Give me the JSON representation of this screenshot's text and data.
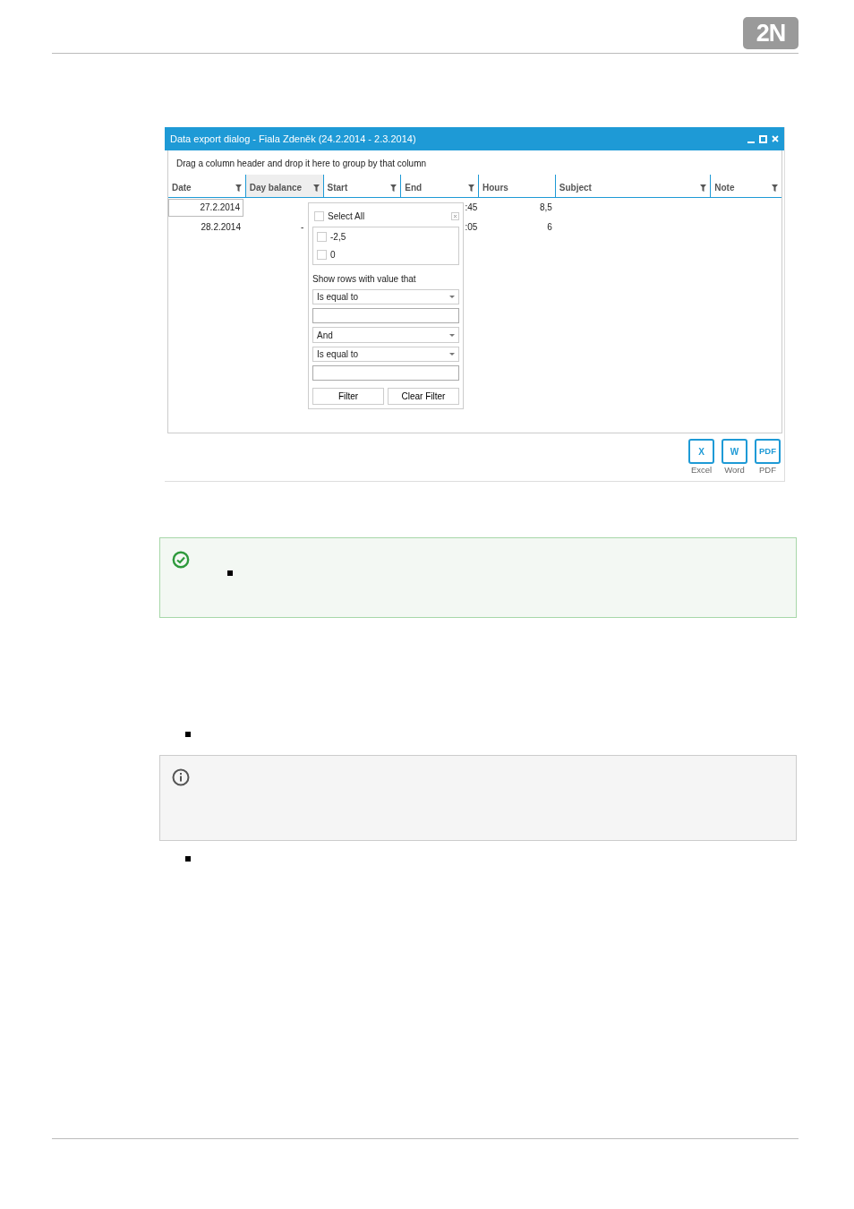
{
  "logo": "2N",
  "dialog": {
    "title": "Data export dialog - Fiala Zdeněk (24.2.2014 - 2.3.2014)",
    "group_hint": "Drag a column header and drop it here to group by that column",
    "columns": [
      {
        "label": "Date",
        "filter": true,
        "selected": false
      },
      {
        "label": "Day balance",
        "filter": true,
        "selected": true
      },
      {
        "label": "Start",
        "filter": true,
        "selected": false
      },
      {
        "label": "End",
        "filter": true,
        "selected": false
      },
      {
        "label": "Hours",
        "filter": false,
        "selected": false
      },
      {
        "label": "Subject",
        "filter": true,
        "selected": false
      },
      {
        "label": "Note",
        "filter": true,
        "selected": false
      }
    ],
    "rows": [
      {
        "date": "27.2.2014",
        "end": ":45",
        "hours": "8,5",
        "focused": true
      },
      {
        "date": "28.2.2014",
        "day_balance": "-",
        "end": ":05",
        "hours": "6",
        "focused": false
      }
    ],
    "filter_popup": {
      "select_all": {
        "label": "Select All",
        "checked": false
      },
      "values": [
        {
          "label": "-2,5",
          "checked": false
        },
        {
          "label": "0",
          "checked": false
        }
      ],
      "prompt": "Show rows with value that",
      "operator_1": "Is equal to",
      "logic": "And",
      "operator_2": "Is equal to",
      "buttons": [
        "Filter",
        "Clear Filter"
      ]
    },
    "export_buttons": [
      {
        "label": "Excel",
        "glyph": "X"
      },
      {
        "label": "Word",
        "glyph": "W"
      },
      {
        "label": "PDF",
        "glyph": "PDF"
      }
    ]
  },
  "blocks": [
    {
      "kind": "success_note",
      "items": [
        {
          "kind": "bullet"
        }
      ]
    },
    {
      "kind": "bullet"
    },
    {
      "kind": "info_note"
    },
    {
      "kind": "bullet"
    }
  ]
}
